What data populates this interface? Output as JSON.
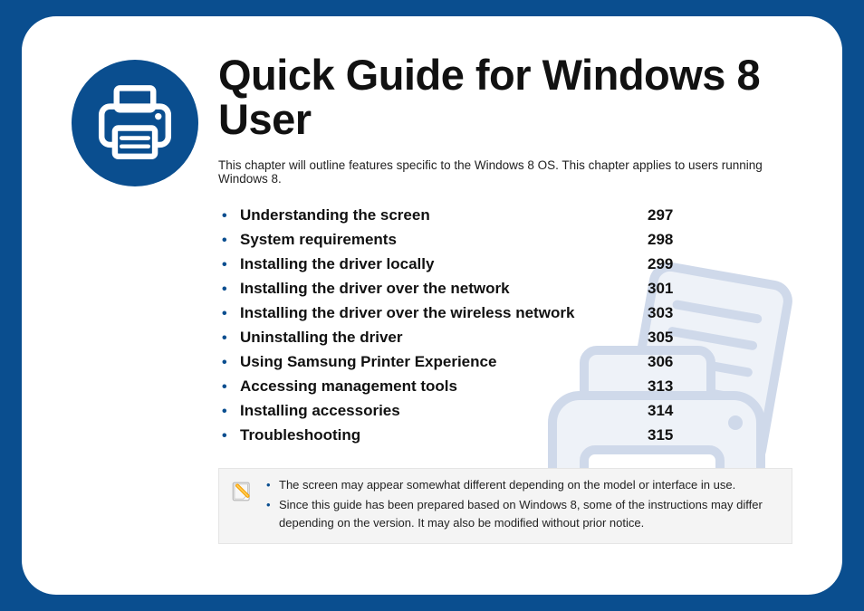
{
  "title": "Quick Guide for Windows 8 User",
  "intro": "This chapter will outline features specific to the Windows 8 OS. This chapter applies to users running Windows 8.",
  "toc": [
    {
      "label": "Understanding the screen",
      "page": "297"
    },
    {
      "label": "System requirements",
      "page": "298"
    },
    {
      "label": "Installing the driver locally",
      "page": "299"
    },
    {
      "label": "Installing the driver over the network",
      "page": "301"
    },
    {
      "label": "Installing the driver over the wireless network",
      "page": "303"
    },
    {
      "label": "Uninstalling the driver",
      "page": "305"
    },
    {
      "label": "Using Samsung Printer Experience",
      "page": "306"
    },
    {
      "label": "Accessing management tools",
      "page": "313"
    },
    {
      "label": "Installing accessories",
      "page": "314"
    },
    {
      "label": "Troubleshooting",
      "page": "315"
    }
  ],
  "notes": [
    "The screen may appear somewhat different depending on the model or interface in use.",
    "Since this guide has been prepared based on Windows 8, some of the instructions may differ depending on the version. It may also be modified without prior notice."
  ],
  "colors": {
    "brand": "#0a4e8f"
  },
  "icons": {
    "header": "printer-icon",
    "note": "note-icon",
    "watermark": "printer-paper-icon"
  }
}
